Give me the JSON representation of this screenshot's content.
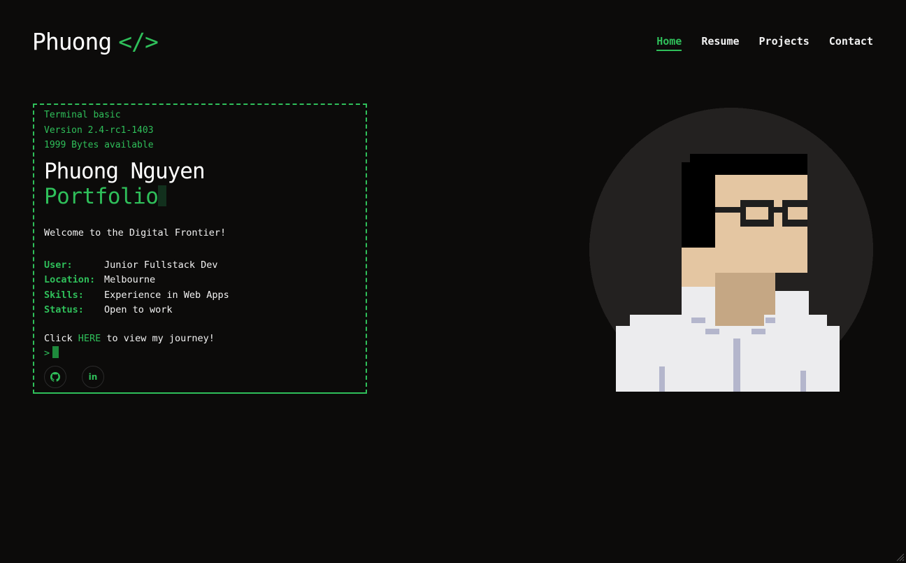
{
  "brand": {
    "name": "Phuong",
    "tag": "</>"
  },
  "nav": {
    "home": "Home",
    "resume": "Resume",
    "projects": "Projects",
    "contact": "Contact"
  },
  "terminal": {
    "line1": "Terminal basic",
    "line2": "Version 2.4-rc1-1403",
    "line3": "1999 Bytes available",
    "name": "Phuong Nguyen",
    "title": "Portfolio",
    "welcome": "Welcome to the Digital Frontier!",
    "info": [
      {
        "key": "User:",
        "value": "Junior Fullstack Dev"
      },
      {
        "key": "Location:",
        "value": "Melbourne"
      },
      {
        "key": "Skills:",
        "value": "Experience in Web Apps"
      },
      {
        "key": "Status:",
        "value": "Open to work"
      }
    ],
    "click_prefix": "Click ",
    "click_link": "HERE",
    "click_suffix": " to view my journey!",
    "prompt": ">",
    "social": {
      "github": "github-icon",
      "linkedin": "in"
    }
  },
  "colors": {
    "accent": "#2fbf5a",
    "background": "#0c0b0a",
    "circle": "#232120"
  }
}
